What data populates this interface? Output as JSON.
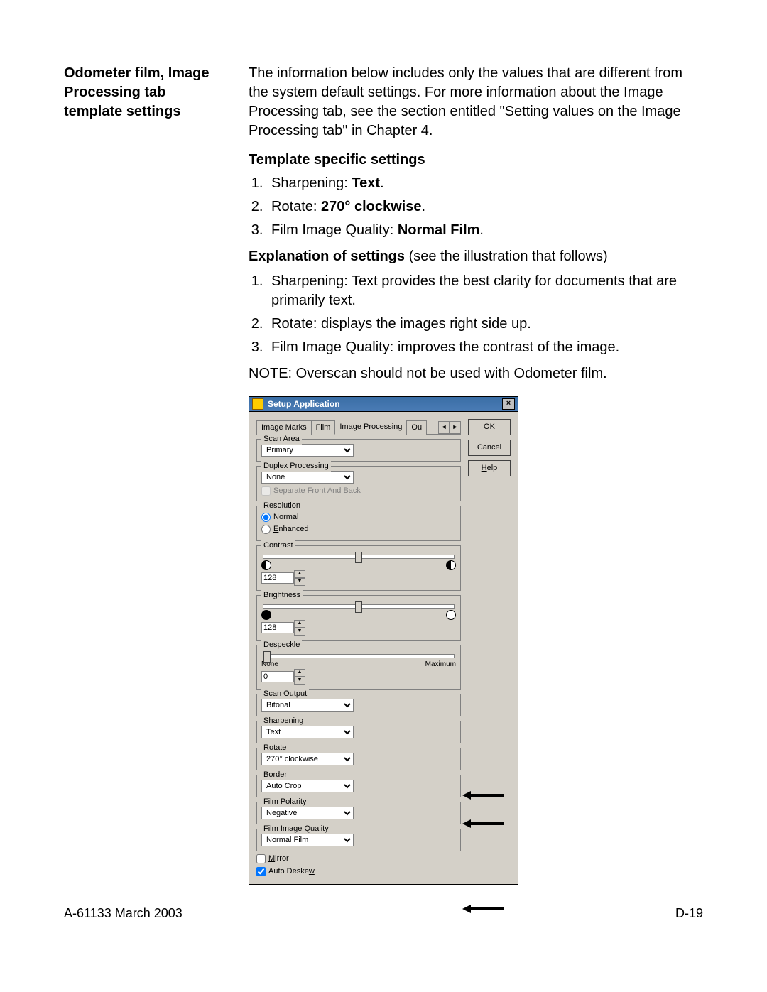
{
  "left": {
    "title": "Odometer film, Image Processing tab template settings"
  },
  "right": {
    "intro": "The information below includes only the values that are different from the system default settings.  For more information about the Image Processing tab, see the section entitled \"Setting values on the Image Processing tab\" in Chapter 4.",
    "sub1": "Template specific settings",
    "list1": {
      "i1a": "Sharpening: ",
      "i1b": "Text",
      "i1c": ".",
      "i2a": "Rotate: ",
      "i2b": "270° clockwise",
      "i2c": ".",
      "i3a": "Film Image Quality: ",
      "i3b": "Normal Film",
      "i3c": "."
    },
    "sub2a": "Explanation of settings",
    "sub2b": " (see the illustration that follows)",
    "list2": {
      "i1": "Sharpening: Text provides the best clarity for documents that are primarily text.",
      "i2": "Rotate: displays the images right side up.",
      "i3": "Film Image Quality: improves the contrast of the image."
    },
    "note": "NOTE:  Overscan should not be used with Odometer film."
  },
  "dlg": {
    "title": "Setup Application",
    "close": "×",
    "tabs": {
      "t1": "Image Marks",
      "t2": "Film",
      "t3": "Image Processing",
      "t4": "Ou"
    },
    "buttons": {
      "ok_pre": "O",
      "ok_u": "K",
      "cancel": "Cancel",
      "help_u": "H",
      "help_post": "elp"
    },
    "scanArea": {
      "legend_u": "S",
      "legend": "can Area",
      "value": "Primary"
    },
    "duplex": {
      "legend_u": "D",
      "legend": "uplex Processing",
      "value": "None",
      "sep_label": "Separate Front And Back"
    },
    "resolution": {
      "legend": "Resolution",
      "normal_u": "N",
      "normal": "ormal",
      "enhanced_u": "E",
      "enhanced": "nhanced"
    },
    "contrast": {
      "legend": "Contrast",
      "value": "128"
    },
    "brightness": {
      "legend": "Brightness",
      "value": "128"
    },
    "despeckle": {
      "legend_pre": "Despec",
      "legend_u": "k",
      "legend_post": "le",
      "left": "None",
      "right": "Maximum",
      "value": "0"
    },
    "scanOutput": {
      "legend": "Scan Output",
      "value": "Bitonal"
    },
    "sharpening": {
      "legend_pre": "Shar",
      "legend_u": "p",
      "legend_post": "ening",
      "value": "Text"
    },
    "rotate": {
      "legend_pre": "Ro",
      "legend_u": "t",
      "legend_post": "ate",
      "value": "270° clockwise"
    },
    "border": {
      "legend_u": "B",
      "legend": "order",
      "value": "Auto Crop"
    },
    "polarity": {
      "legend": "Film Polarity",
      "value": "Negative"
    },
    "quality": {
      "legend_pre": "Film Image ",
      "legend_u": "Q",
      "legend_post": "uality",
      "value": "Normal Film"
    },
    "mirror": {
      "u": "M",
      "rest": "irror"
    },
    "deskew": {
      "pre": "Auto Deske",
      "u": "w"
    }
  },
  "footer": {
    "left": "A-61133  March 2003",
    "right": "D-19"
  }
}
